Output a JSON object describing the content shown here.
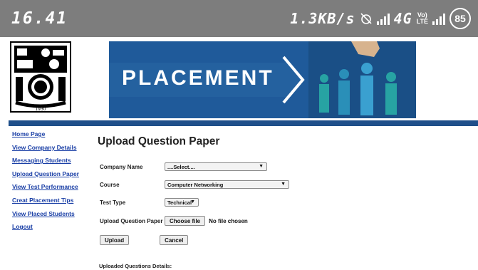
{
  "status_bar": {
    "time": "16.41",
    "net_speed": "1.3KB/s",
    "net_type": "4G",
    "volte_top": "Vo)",
    "volte_bottom": "LTE",
    "battery": "85"
  },
  "header": {
    "banner_title": "PLACEMENT",
    "logo_year": "1930",
    "colors": {
      "banner": "#1f5a9a",
      "strip": "#1f4f8a"
    }
  },
  "sidebar": {
    "items": [
      {
        "label": "Home Page"
      },
      {
        "label": "View Company Details"
      },
      {
        "label": "Messaging Students"
      },
      {
        "label": "Upload Question Paper"
      },
      {
        "label": "View Test Performance"
      },
      {
        "label": "Creat Placement Tips"
      },
      {
        "label": "View Placed Students"
      },
      {
        "label": "Logout"
      }
    ]
  },
  "main": {
    "title": "Upload Question Paper",
    "form": {
      "company_label": "Company Name",
      "company_value": "....Select....",
      "course_label": "Course",
      "course_value": "Computer Networking",
      "test_type_label": "Test Type",
      "test_type_value": "Technical",
      "upload_label": "Upload Question Paper",
      "choose_file_label": "Choose file",
      "file_status": "No file chosen",
      "upload_button": "Upload",
      "cancel_button": "Cancel"
    },
    "details_heading": "Uploaded Questions Details:"
  }
}
